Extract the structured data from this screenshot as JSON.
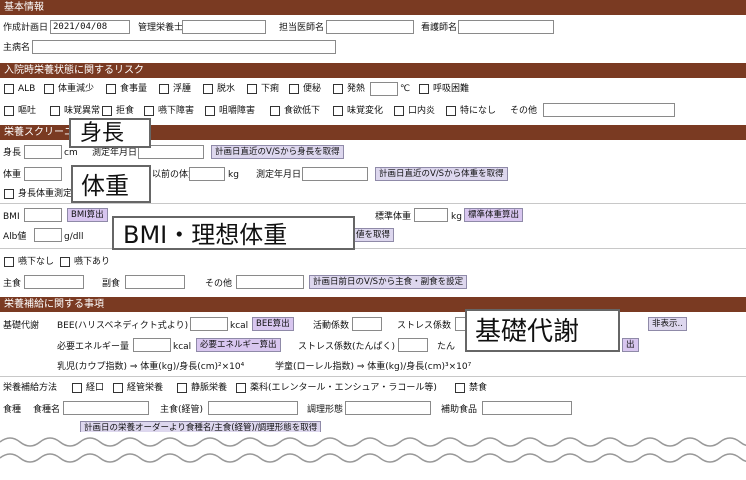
{
  "sections": {
    "basic": "基本情報",
    "risk": "入院時栄養状態に関するリスク",
    "screening": "栄養スクリーニング",
    "support": "栄養補給に関する事項"
  },
  "basic": {
    "plan_date_label": "作成計画日",
    "plan_date_value": "2021/04/08",
    "dietitian_label": "管理栄養士",
    "doctor_label": "担当医師名",
    "nurse_label": "看護師名",
    "disease_label": "主病名"
  },
  "risk": {
    "row1": [
      "ALB",
      "体重減少",
      "食事量",
      "浮腫",
      "脱水",
      "下痢",
      "便秘",
      "発熱",
      "呼吸困難"
    ],
    "fever_unit": "℃",
    "row2": [
      "嘔吐",
      "味覚異常",
      "拒食",
      "嚥下障害",
      "咀嚼障害",
      "食欲低下",
      "味覚変化",
      "口内炎",
      "特になし"
    ],
    "other_label": "その他"
  },
  "screening": {
    "height_label": "身長",
    "height_unit": "cm",
    "height_date_label": "測定年月日",
    "height_btn": "計画日直近のV/Sから身長を取得",
    "weight_label": "体重",
    "prev_weight_label": "以前の体重",
    "weight_unit": "kg",
    "weight_date_label": "測定年月日",
    "weight_btn": "計画日直近のV/Sから体重を取得",
    "unmeasurable_label": "身長体重測定不可",
    "bmi_label": "BMI",
    "bmi_btn": "BMI算出",
    "std_weight_label": "標準体重",
    "std_weight_unit": "kg",
    "std_weight_btn": "標準体重算出",
    "alb_label": "Alb値",
    "alb_unit": "g/dll",
    "alb_btn": "値を取得",
    "swallow_none": "嚥下なし",
    "swallow_yes": "嚥下あり",
    "main_food_label": "主食",
    "side_food_label": "副食",
    "other_food_label": "その他",
    "food_btn": "計画日前日のV/Sから主食・副食を設定"
  },
  "support": {
    "bee_section_label": "基礎代謝",
    "bee_label": "BEE(ハリスベネディクト式より)",
    "kcal_unit": "kcal",
    "bee_btn": "BEE算出",
    "activity_label": "活動係数",
    "stress_label": "ストレス係数",
    "hidden_btn": "非表示..",
    "energy_label": "必要エネルギー量",
    "energy_btn": "必要エネルギー算出",
    "stress_protein_label": "ストレス係数(たんぱく)",
    "protein_label": "たん",
    "protein_btn": "出",
    "formula1": "乳児(カウプ指数) ⇒ 体重(kg)/身長(cm)²×10⁴",
    "formula2": "学童(ローレル指数) ⇒ 体重(kg)/身長(cm)³×10⁷",
    "method_label": "栄養補給方法",
    "methods": [
      "経口",
      "経管栄養",
      "静脈栄養",
      "薬科(エレンタール・エンシュア・ラコール等)",
      "禁食"
    ],
    "meal_label": "食種",
    "meal_name_label": "食種名",
    "main_food_label": "主食(経管)",
    "form_label": "調理形態",
    "supplement_label": "補助食品",
    "order_btn": "計画日の栄養オーダーより食種名/主食(経管)/調理形態を取得"
  },
  "callouts": {
    "height": "身長",
    "weight": "体重",
    "bmi": "BMI・理想体重",
    "bee": "基礎代謝"
  }
}
